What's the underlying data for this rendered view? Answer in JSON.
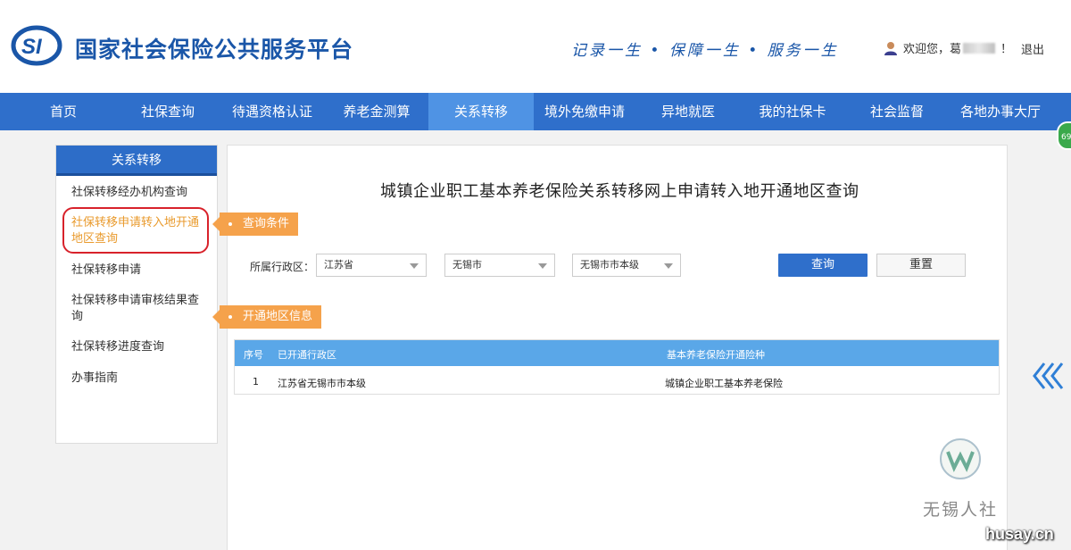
{
  "header": {
    "site_title": "国家社会保险公共服务平台",
    "slogan": "记录一生 • 保障一生 • 服务一生",
    "welcome": "欢迎您，葛",
    "welcome_suffix": "！",
    "logout": "退出"
  },
  "nav": {
    "items": [
      {
        "label": "首页"
      },
      {
        "label": "社保查询"
      },
      {
        "label": "待遇资格认证"
      },
      {
        "label": "养老金测算"
      },
      {
        "label": "关系转移"
      },
      {
        "label": "境外免缴申请"
      },
      {
        "label": "异地就医"
      },
      {
        "label": "我的社保卡"
      },
      {
        "label": "社会监督"
      },
      {
        "label": "各地办事大厅"
      }
    ],
    "active_index": 4,
    "badge": "69"
  },
  "sidebar": {
    "title": "关系转移",
    "items": [
      {
        "label": "社保转移经办机构查询"
      },
      {
        "label": "社保转移申请转入地开通地区查询"
      },
      {
        "label": "社保转移申请"
      },
      {
        "label": "社保转移申请审核结果查询"
      },
      {
        "label": "社保转移进度查询"
      },
      {
        "label": "办事指南"
      }
    ]
  },
  "main": {
    "title": "城镇企业职工基本养老保险关系转移网上申请转入地开通地区查询",
    "query_tag": "查询条件",
    "region_label": "所属行政区：",
    "province_select": "江苏省",
    "city_select": "无锡市",
    "district_select": "无锡市市本级",
    "query_button": "查询",
    "reset_button": "重置",
    "result_tag": "开通地区信息",
    "table": {
      "headers": [
        "序号",
        "已开通行政区",
        "基本养老保险开通险种"
      ],
      "rows": [
        [
          "1",
          "江苏省无锡市市本级",
          "城镇企业职工基本养老保险"
        ]
      ]
    }
  },
  "watermark": {
    "org": "无锡人社",
    "site": "husay.cn"
  },
  "colors": {
    "brand_blue": "#2f6fcb",
    "nav_active": "#4f93e4",
    "tag_orange": "#f5a24b",
    "table_header": "#5aa7e8",
    "highlight_ring": "#d8222b"
  }
}
